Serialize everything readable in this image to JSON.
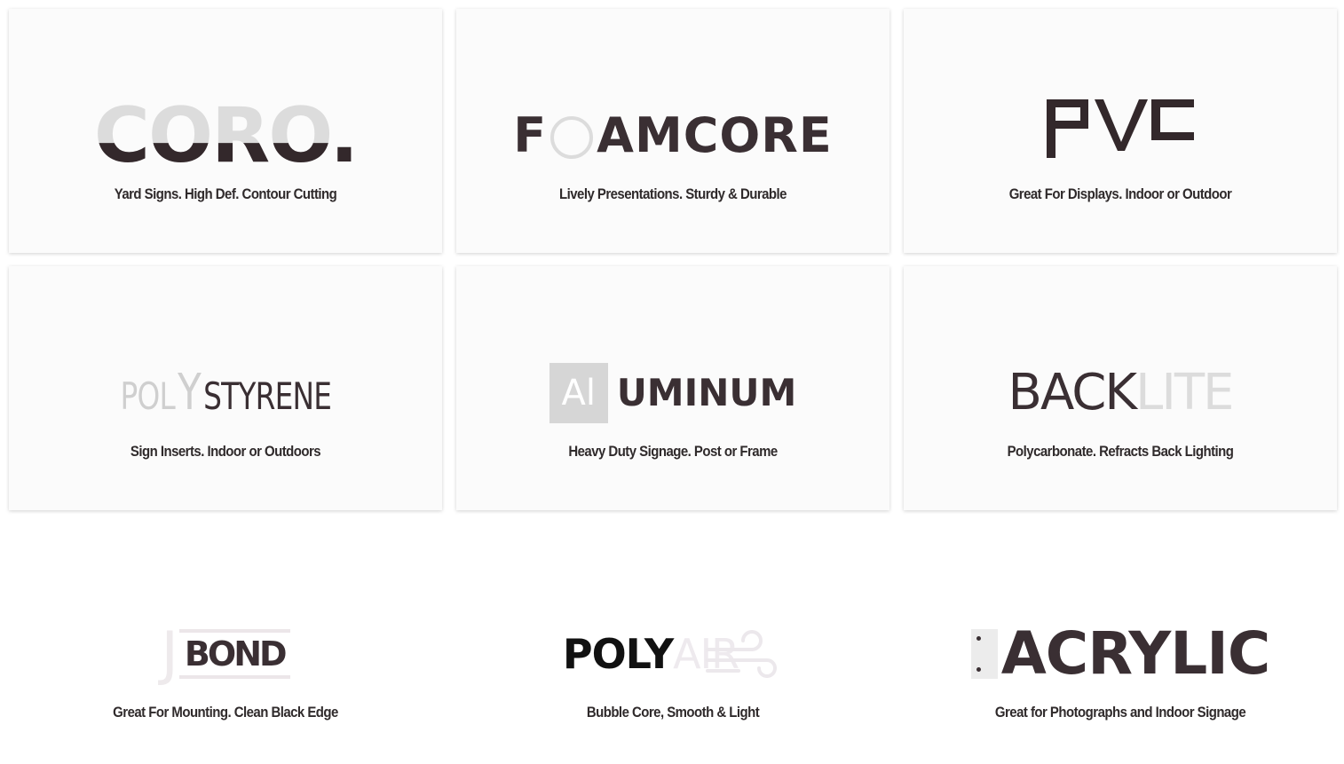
{
  "cards": [
    {
      "logo": {
        "text": "CORO."
      },
      "tagline": "Yard Signs. High Def. Contour Cutting"
    },
    {
      "logo": {
        "text_a": "F",
        "text_b": "AMCORE"
      },
      "tagline": "Lively Presentations. Sturdy & Durable"
    },
    {
      "logo": {
        "text": "PVC"
      },
      "tagline": "Great For Displays. Indoor or Outdoor"
    },
    {
      "logo": {
        "text_a": "POL",
        "text_b": "Y",
        "text_c": "STYRENE"
      },
      "tagline": "Sign Inserts. Indoor or Outdoors"
    },
    {
      "logo": {
        "text_a": "Al",
        "text_b": "UMINUM"
      },
      "tagline": "Heavy Duty Signage. Post or Frame"
    },
    {
      "logo": {
        "text_a": "BACK",
        "text_b": "LITE"
      },
      "tagline": "Polycarbonate. Refracts Back Lighting"
    },
    {
      "logo": {
        "text_a": "J",
        "text_b": "BOND"
      },
      "tagline": "Great For Mounting. Clean Black Edge"
    },
    {
      "logo": {
        "text_a": "POLY",
        "text_b": "AIR"
      },
      "tagline": "Bubble Core, Smooth & Light"
    },
    {
      "logo": {
        "text": "ACRYLIC"
      },
      "tagline": "Great for Photographs and Indoor Signage"
    }
  ],
  "colors": {
    "dark": "#3a2f33",
    "light": "#dcdcdc",
    "tagline": "#2f2a2b"
  },
  "icons": {
    "pvc": "pvc-logo-icon",
    "polyair": "wind-icon",
    "acrylic": "standoff-panel-icon"
  }
}
